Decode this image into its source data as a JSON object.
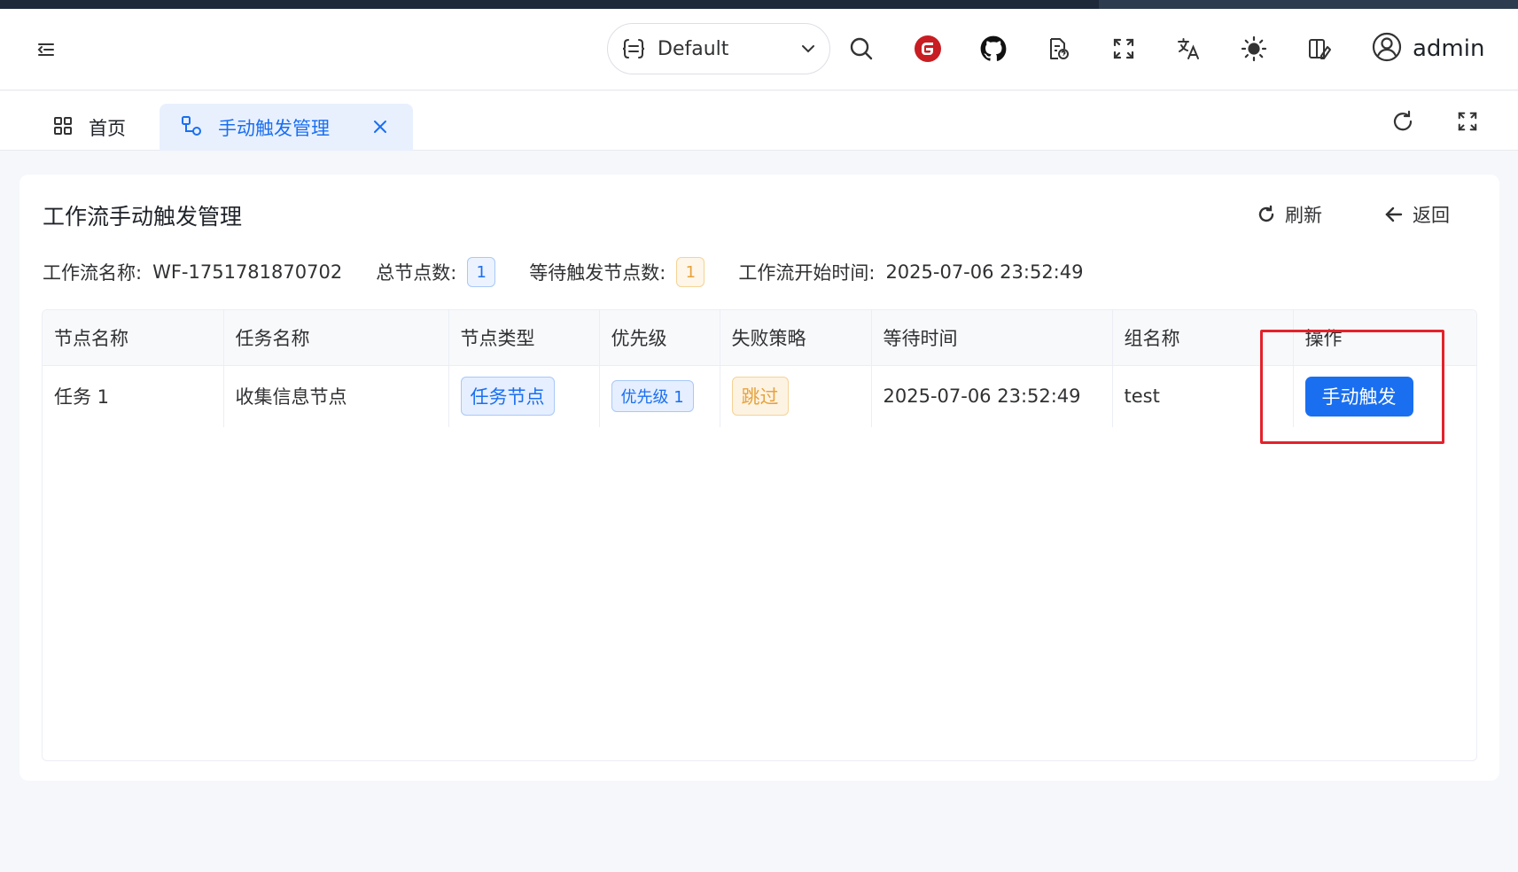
{
  "header": {
    "namespace": "Default",
    "user": "admin"
  },
  "tabs": {
    "home": "首页",
    "active": "手动触发管理"
  },
  "page": {
    "title": "工作流手动触发管理",
    "refresh": "刷新",
    "back": "返回"
  },
  "info": {
    "workflow_name_label": "工作流名称:",
    "workflow_name": "WF-1751781870702",
    "total_nodes_label": "总节点数:",
    "total_nodes": "1",
    "waiting_nodes_label": "等待触发节点数:",
    "waiting_nodes": "1",
    "start_time_label": "工作流开始时间:",
    "start_time": "2025-07-06 23:52:49"
  },
  "table": {
    "columns": [
      "节点名称",
      "任务名称",
      "节点类型",
      "优先级",
      "失败策略",
      "等待时间",
      "组名称",
      "操作"
    ],
    "rows": [
      {
        "node_name": "任务 1",
        "task_name": "收集信息节点",
        "node_type": "任务节点",
        "priority": "优先级 1",
        "fail_strategy": "跳过",
        "wait_time": "2025-07-06 23:52:49",
        "group": "test",
        "action": "手动触发"
      }
    ]
  },
  "colors": {
    "primary": "#1a6ff0",
    "warning": "#e6a23c",
    "highlight": "#e3222b"
  }
}
